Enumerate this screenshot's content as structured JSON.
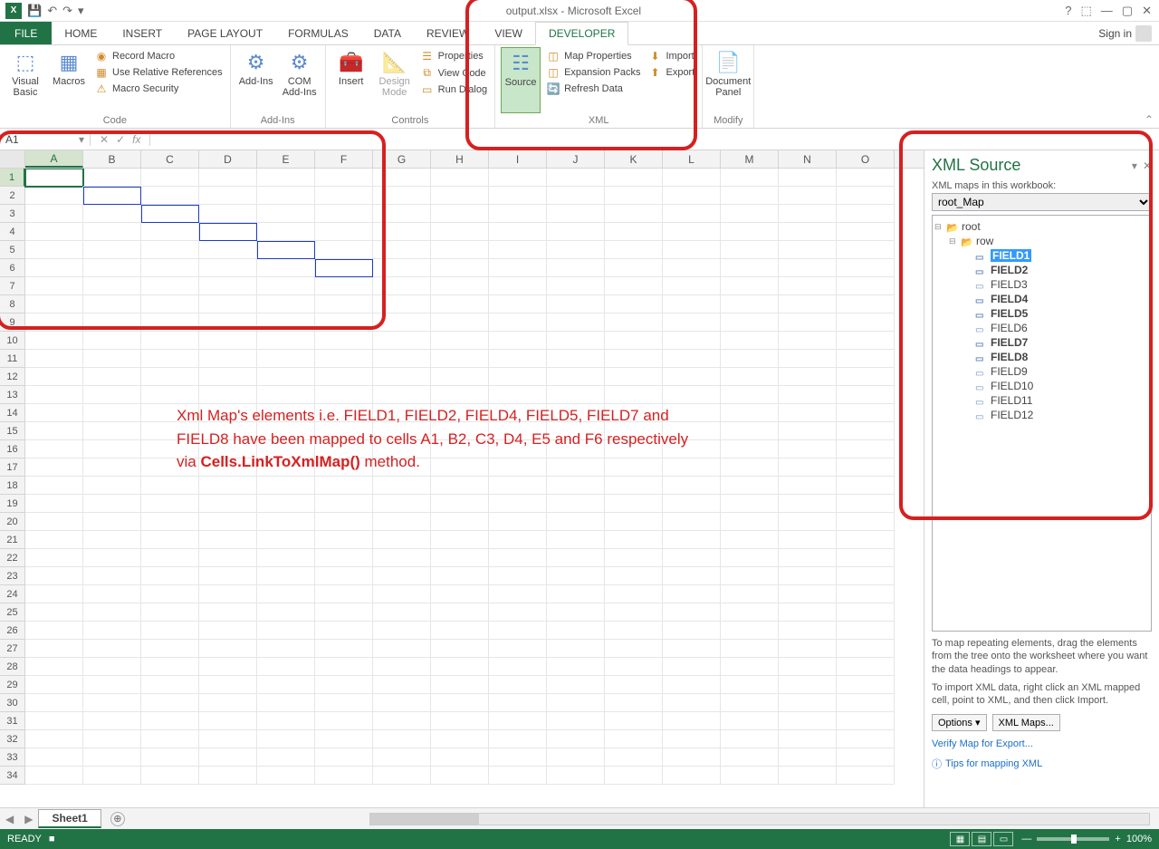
{
  "titlebar": {
    "title": "output.xlsx - Microsoft Excel",
    "help": "?"
  },
  "ribbon_tabs": {
    "file": "FILE",
    "tabs": [
      "HOME",
      "INSERT",
      "PAGE LAYOUT",
      "FORMULAS",
      "DATA",
      "REVIEW",
      "VIEW",
      "DEVELOPER"
    ],
    "active": "DEVELOPER",
    "signin": "Sign in"
  },
  "ribbon": {
    "code": {
      "visual_basic": "Visual Basic",
      "macros": "Macros",
      "record_macro": "Record Macro",
      "use_rel_refs": "Use Relative References",
      "macro_security": "Macro Security",
      "label": "Code"
    },
    "addins": {
      "addins": "Add-Ins",
      "com_addins": "COM Add-Ins",
      "label": "Add-Ins"
    },
    "controls": {
      "insert": "Insert",
      "design_mode": "Design Mode",
      "properties": "Properties",
      "view_code": "View Code",
      "run_dialog": "Run Dialog",
      "label": "Controls"
    },
    "xml": {
      "source": "Source",
      "map_properties": "Map Properties",
      "expansion_packs": "Expansion Packs",
      "refresh_data": "Refresh Data",
      "import": "Import",
      "export": "Export",
      "label": "XML"
    },
    "modify": {
      "document_panel": "Document Panel",
      "label": "Modify"
    }
  },
  "formula_bar": {
    "name_box": "A1",
    "fx": "fx"
  },
  "grid": {
    "columns": [
      "A",
      "B",
      "C",
      "D",
      "E",
      "F",
      "G",
      "H",
      "I",
      "J",
      "K",
      "L",
      "M",
      "N",
      "O"
    ],
    "row_count": 34,
    "active_col": "A",
    "active_row": 1,
    "selected_cell": "A1",
    "mapped_cells": [
      "A1",
      "B2",
      "C3",
      "D4",
      "E5",
      "F6"
    ]
  },
  "annotation": {
    "line1": "Xml Map's elements i.e. FIELD1, FIELD2, FIELD4, FIELD5, FIELD7 and",
    "line2": "FIELD8 have been mapped to cells A1, B2, C3, D4, E5 and F6 respectively",
    "line3_pre": "via ",
    "line3_b": "Cells.LinkToXmlMap()",
    "line3_post": " method."
  },
  "xml_pane": {
    "title": "XML Source",
    "maps_label": "XML maps in this workbook:",
    "selected_map": "root_Map",
    "tree": {
      "root": "root",
      "row": "row",
      "fields": [
        {
          "name": "FIELD1",
          "bold": true,
          "selected": true
        },
        {
          "name": "FIELD2",
          "bold": true
        },
        {
          "name": "FIELD3",
          "bold": false
        },
        {
          "name": "FIELD4",
          "bold": true
        },
        {
          "name": "FIELD5",
          "bold": true
        },
        {
          "name": "FIELD6",
          "bold": false
        },
        {
          "name": "FIELD7",
          "bold": true
        },
        {
          "name": "FIELD8",
          "bold": true
        },
        {
          "name": "FIELD9",
          "bold": false
        },
        {
          "name": "FIELD10",
          "bold": false
        },
        {
          "name": "FIELD11",
          "bold": false
        },
        {
          "name": "FIELD12",
          "bold": false
        }
      ]
    },
    "hint1": "To map repeating elements, drag the elements from the tree onto the worksheet where you want the data headings to appear.",
    "hint2": "To import XML data, right click an XML mapped cell, point to XML, and then click Import.",
    "options_btn": "Options ▾",
    "xml_maps_btn": "XML Maps...",
    "verify_link": "Verify Map for Export...",
    "tips_link": "Tips for mapping XML"
  },
  "sheet_bar": {
    "sheet1": "Sheet1",
    "add": "⊕"
  },
  "status": {
    "ready": "READY",
    "record_icon": "■",
    "zoom": "100%"
  }
}
